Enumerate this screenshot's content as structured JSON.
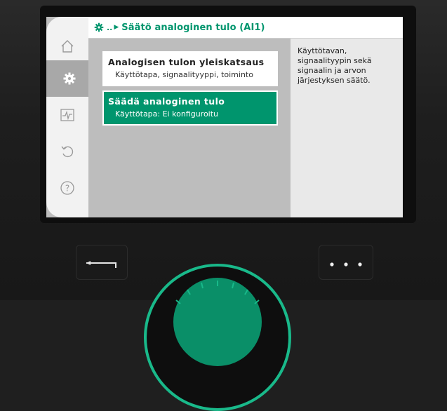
{
  "header": {
    "breadcrumb_dots": "..",
    "title": "Säätö analoginen tulo (AI1)"
  },
  "sidebar": {
    "items": [
      {
        "name": "home",
        "icon": "home-icon",
        "active": false
      },
      {
        "name": "settings",
        "icon": "gear-icon",
        "active": true
      },
      {
        "name": "diagnostics",
        "icon": "pulse-icon",
        "active": false
      },
      {
        "name": "restore",
        "icon": "undo-icon",
        "active": false
      },
      {
        "name": "help",
        "icon": "help-icon",
        "active": false
      }
    ]
  },
  "menu": {
    "items": [
      {
        "title": "Analogisen tulon yleiskatsaus",
        "subtitle": "Käyttötapa, signaalityyppi, toiminto",
        "selected": false
      },
      {
        "title": "Säädä analoginen tulo",
        "subtitle": "Käyttötapa: Ei konfiguroitu",
        "selected": true
      }
    ]
  },
  "info_panel": {
    "text": "Käyttötavan, signaalityypin sekä signaalin ja arvon järjestyksen säätö."
  },
  "controls": {
    "back_icon": "back-arrow-icon",
    "more_icon": "more-dots-icon",
    "knob_icon": "rotary-knob"
  },
  "colors": {
    "accent": "#00956d",
    "knob_ring": "#19b98a"
  }
}
